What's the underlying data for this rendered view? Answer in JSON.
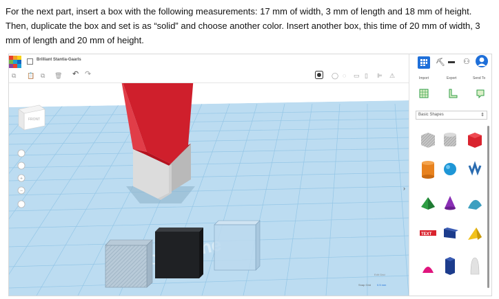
{
  "instructions": {
    "text": "For the next part, insert a box with the following measurements: 17 mm of width, 3 mm of length and 18 mm of height. Then, duplicate the box and set is as “solid” and choose another color. Insert another box, this time of 20 mm of width, 3 mm of length and 20 mm of height."
  },
  "app": {
    "design_name": "Brilliant Stantia-Gaarls",
    "logo_colors": [
      "#e8412c",
      "#f2a125",
      "#f7d219",
      "#7ab648",
      "#1e9fd6",
      "#1565c0",
      "#8b3f9c",
      "#e8412c",
      "#1e9fd6"
    ],
    "toolbar": {
      "import_label": "Import",
      "export_label": "Export",
      "send_to_label": "Send To"
    },
    "panel": {
      "category_label": "Basic Shapes"
    },
    "viewcube": {
      "face_label": "FRONT"
    },
    "workplane": {
      "label": "Workplane",
      "edit_grid_label": "Edit Grid",
      "snap_grid_label": "Snap Grid",
      "snap_grid_value": "0.5 mm"
    },
    "colors": {
      "accent": "#1e6fd9",
      "grid_bg": "#b9dcf2",
      "grid_line": "#8fc4e6",
      "red_shape": "#cc1f2c",
      "gray_box": "#d8d8d8",
      "black_box": "#1f2124",
      "hole_box": "#a9bdcd",
      "glass_box": "#bcd9ee"
    },
    "shapes": [
      {
        "name": "box-hole-icon",
        "color": "#b5b5b5"
      },
      {
        "name": "cylinder-hole-icon",
        "color": "#b5b5b5"
      },
      {
        "name": "box-icon",
        "color": "#d9232e"
      },
      {
        "name": "cylinder-icon",
        "color": "#e8821e"
      },
      {
        "name": "sphere-icon",
        "color": "#1e96d6"
      },
      {
        "name": "scribble-icon",
        "color": "#2b6cb0"
      },
      {
        "name": "roof-icon",
        "color": "#2e9e44"
      },
      {
        "name": "cone-icon",
        "color": "#8a2fb5"
      },
      {
        "name": "round-roof-icon",
        "color": "#3ea0c0"
      },
      {
        "name": "text-icon",
        "color": "#d9232e"
      },
      {
        "name": "wedge-icon",
        "color": "#1c3c8c"
      },
      {
        "name": "pyramid-icon",
        "color": "#f2c21c"
      },
      {
        "name": "half-sphere-icon",
        "color": "#e0157d"
      },
      {
        "name": "polygon-icon",
        "color": "#1c3c8c"
      },
      {
        "name": "paraboloid-icon",
        "color": "#d8d8d8"
      }
    ]
  }
}
